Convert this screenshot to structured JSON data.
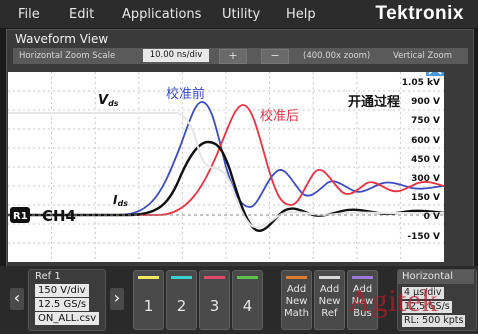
{
  "menu": {
    "items": [
      "File",
      "Edit",
      "Applications",
      "Utility",
      "Help"
    ],
    "brand": "Tektronix"
  },
  "waveform_view": {
    "title": "Waveform View",
    "zoom_label": "Horizontal Zoom Scale",
    "zoom_value": "10.00 ns/div",
    "plus_label": "+",
    "minus_label": "−",
    "zoom_factor": "(400.00x zoom)",
    "vertical_label": "Vertical Zoom"
  },
  "plot": {
    "y_ticks": [
      "1.05 kV",
      "900 V",
      "750 V",
      "600 V",
      "450 V",
      "300 V",
      "150 V",
      "0 V",
      "-150 V"
    ],
    "vds_label": "V",
    "vds_sub": "ds",
    "ids_label": "I",
    "ids_sub": "ds",
    "before_label": "校准前",
    "after_label": "校准后",
    "process_label": "开通过程",
    "ref_marker": "R1",
    "ch_label": "CH4",
    "colors": {
      "vds": "#e6e6e6",
      "ids_black": "#111111",
      "before": "#3b4cc0",
      "after": "#e53344"
    }
  },
  "bottom": {
    "ref_title": "Ref 1",
    "ref_scale": "150 V/div",
    "ref_rate": "12.5 GS/s",
    "ref_file": "ON_ALL.csv",
    "channels": [
      "1",
      "2",
      "3",
      "4"
    ],
    "channel_colors": [
      "#f2e85a",
      "#3ad1d1",
      "#e34a6a",
      "#5ac04a"
    ],
    "add_buttons": [
      {
        "label": "Add New Math",
        "color": "#e07a2a"
      },
      {
        "label": "Add New Ref",
        "color": "#d8d8d8"
      },
      {
        "label": "Add New Bus",
        "color": "#9a7ad8"
      }
    ],
    "horizontal_title": "Horizontal",
    "horizontal_scale": "4 μs/div",
    "horizontal_rate": "12.5 GS/s",
    "horizontal_rl": "RL: 500 kpts"
  },
  "watermark": "Agitek"
}
